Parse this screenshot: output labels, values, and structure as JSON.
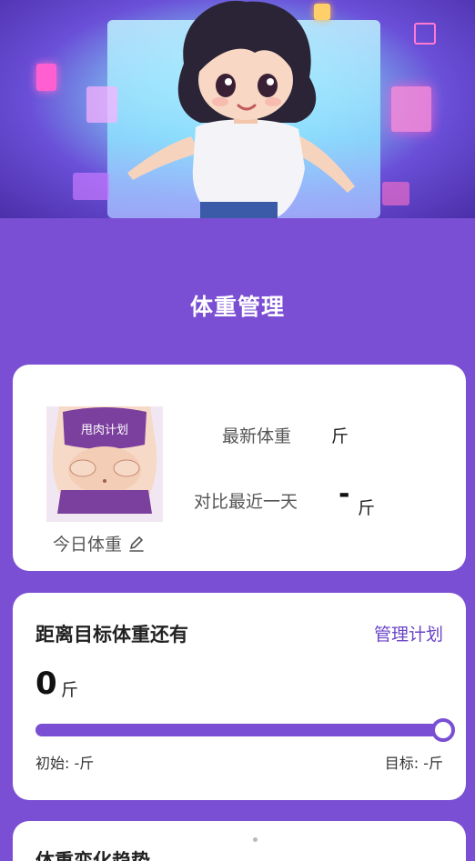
{
  "page": {
    "title": "体重管理"
  },
  "summary_card": {
    "latest_weight_label": "最新体重",
    "latest_weight_unit": "斤",
    "compare_label": "对比最近一天",
    "compare_value": "-",
    "compare_unit": "斤",
    "today_weight_label": "今日体重",
    "avatar_caption": "甩肉计划"
  },
  "goal_card": {
    "title": "距离目标体重还有",
    "manage_link": "管理计划",
    "remaining_value": "0",
    "remaining_unit": "斤",
    "progress_fraction": 1.0,
    "start_label": "初始: -斤",
    "target_label": "目标: -斤"
  },
  "trend_card": {
    "title": "体重变化趋势"
  },
  "colors": {
    "accent": "#7a4fd3",
    "link": "#6a45c8",
    "card": "#ffffff"
  },
  "icons": {
    "edit": "pencil-icon"
  }
}
